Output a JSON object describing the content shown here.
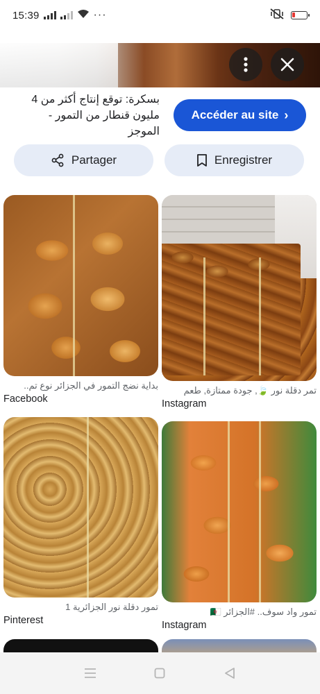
{
  "status_bar": {
    "time": "15:39",
    "more_dots": "···",
    "battery_level": 0.15,
    "battery_color": "#e53935"
  },
  "hero": {
    "more_icon": "more-vert-icon",
    "close_icon": "close-icon"
  },
  "result": {
    "title": "بسكرة: توقع إنتاج أكثر من 4 مليون قنطار من التمور - الموجز",
    "visit_label": "Accéder au site",
    "visit_color": "#1a56d6"
  },
  "actions": {
    "share_label": "Partager",
    "save_label": "Enregistrer",
    "pill_color": "#e6ecf7"
  },
  "related": [
    {
      "caption": "بداية نضج التمور في الجزائر نوع تم..",
      "source": "Facebook"
    },
    {
      "caption": "تمر دقلة نور 🍃, جودة ممتازة, طعم",
      "source": "Instagram"
    },
    {
      "caption": "تمور دقلة نور الجزائرية 1",
      "source": "Pinterest"
    },
    {
      "caption": "تمور واد سوف.. #الجزائر 🇩🇿",
      "source": "Instagram"
    }
  ],
  "navbar": {
    "items": [
      "menu-icon",
      "home-square-icon",
      "back-triangle-icon"
    ]
  }
}
